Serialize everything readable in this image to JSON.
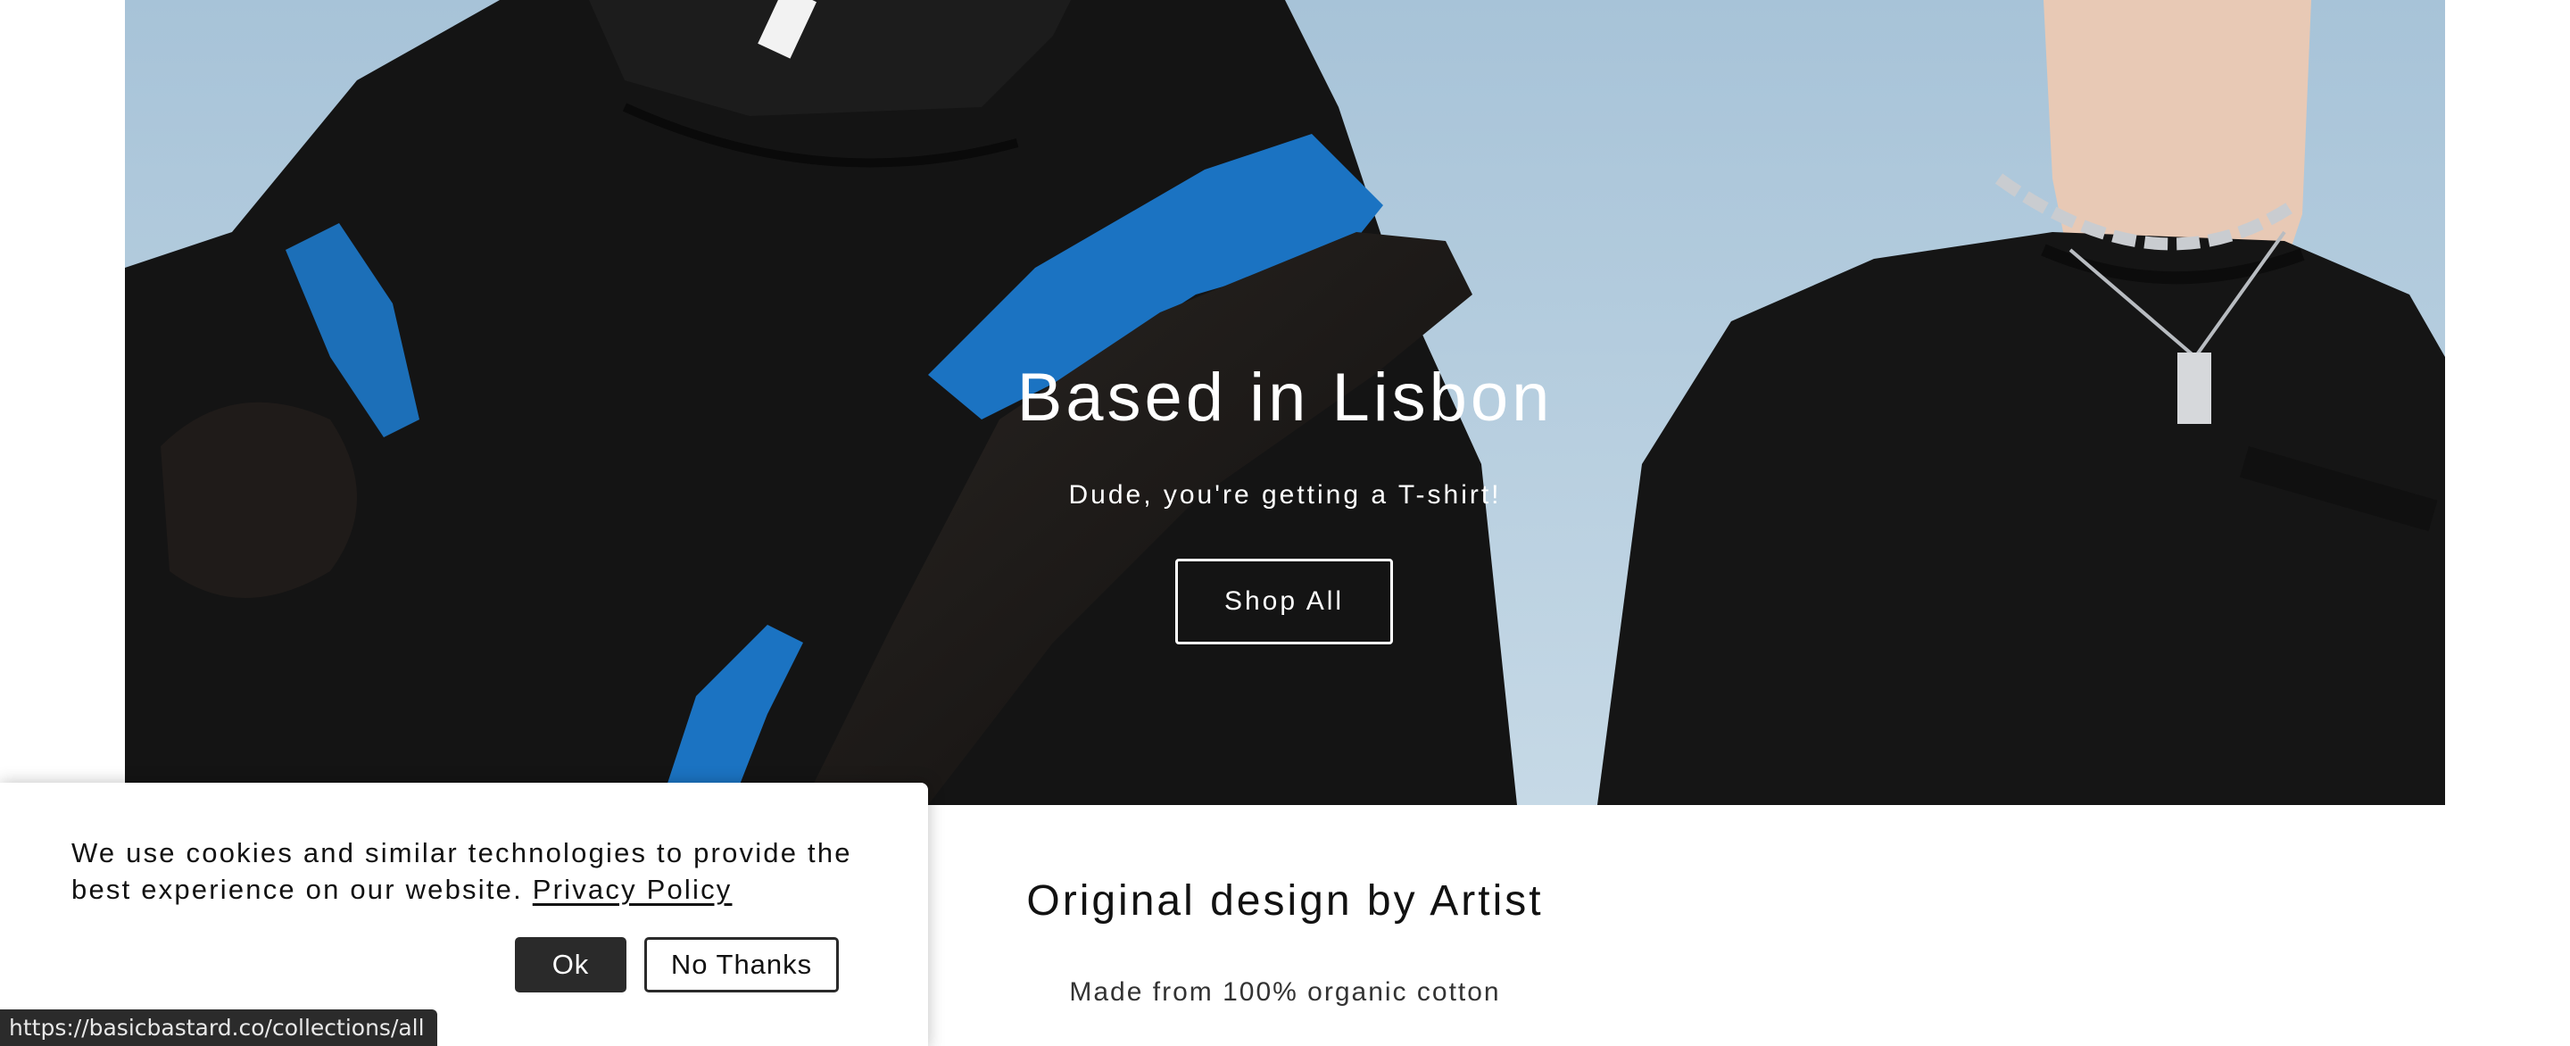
{
  "hero": {
    "title": "Based in Lisbon",
    "subtitle": "Dude, you're getting a T-shirt!",
    "button_label": "Shop All",
    "image_alt": "Two models in black sweatshirts against a blue sky"
  },
  "section": {
    "title": "Original design by Artist",
    "text": "Made from 100% organic cotton"
  },
  "cookie_banner": {
    "message": "We use cookies and similar technologies to provide the best experience on our website.",
    "privacy_link": "Privacy Policy",
    "ok_label": "Ok",
    "no_thanks_label": "No Thanks"
  },
  "status_bar": {
    "url": "https://basicbastard.co/collections/all"
  },
  "colors": {
    "sky": "#b7cfe0",
    "garment_black": "#151515",
    "accent_blue": "#1b73c2",
    "button_dark": "#2a2a2a"
  }
}
